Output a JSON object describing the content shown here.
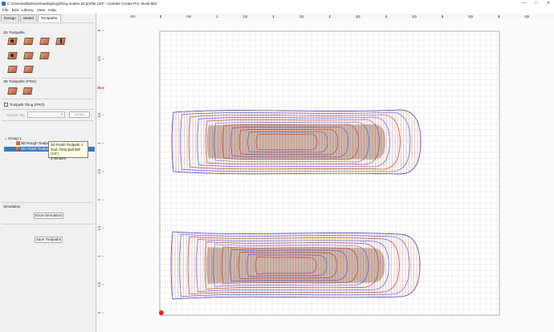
{
  "window": {
    "title": "C:\\Users\\willa\\Downloads\\plough\\boy scales 3d profile.c2d* - Carbide Create Pro, Build 853",
    "controls": [
      "—",
      "□",
      "✕"
    ]
  },
  "menu": [
    "File",
    "Edit",
    "Library",
    "View",
    "Help"
  ],
  "tabs": [
    {
      "label": "Design",
      "active": false
    },
    {
      "label": "Model",
      "active": false
    },
    {
      "label": "Toolpaths",
      "active": true
    }
  ],
  "toolpaths_2d": {
    "heading": "2D Toolpaths"
  },
  "toolpaths_3d": {
    "heading": "3D Toolpaths (PRO)"
  },
  "tiling": {
    "label": "Toolpath Tiling (PRO)",
    "checked": false,
    "current_tile_label": "Current Tile",
    "setup_label": "Setup"
  },
  "tree": {
    "group": "Group 1",
    "items": [
      {
        "label": "3D Rough Toolpath 4 - 9 minutes",
        "selected": false
      },
      {
        "label": "3D Finish Toolpath 4 - 3 minutes",
        "selected": true
      }
    ]
  },
  "tooltip": [
    "3D Finish Toolpath 4",
    "Tool: #202 Ball Mill (1/4\")",
    "3 minutes"
  ],
  "simulation": {
    "heading": "Simulation",
    "show_label": "Show Simulation",
    "save_label": "Save Toolpaths"
  },
  "ruler": {
    "x_ticks": [
      "-0.5",
      "0",
      "0.5",
      "1",
      "1.5",
      "2",
      "2.5",
      "3",
      "3.5",
      "4",
      "4.5",
      "5",
      "5.5",
      "6",
      "6.5"
    ],
    "y_ticks": [
      "5",
      "4.5",
      "4",
      "3.5",
      "3",
      "2.5",
      "2",
      "1.5",
      "1",
      "0.5",
      "0"
    ]
  },
  "colors": {
    "path_red": "#b0302c",
    "path_blue": "#4a4ad0",
    "fill": "#c8b2a6",
    "grid": "#d8d8d8",
    "selection": "#3d7ab9"
  }
}
